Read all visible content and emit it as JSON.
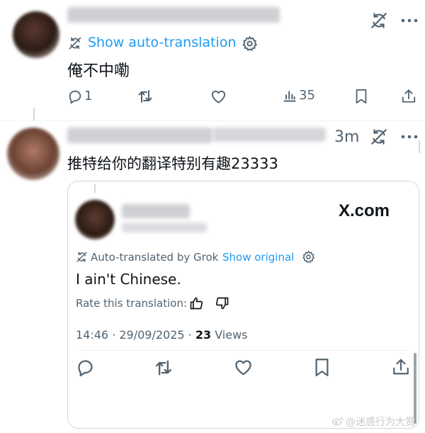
{
  "post1": {
    "show_auto_translation": "Show auto-translation",
    "content": "俺不中嘞",
    "actions": {
      "reply_count": "1",
      "views_count": "35"
    }
  },
  "post2": {
    "time": "3m",
    "content": "推特给你的翻译特别有趣23333"
  },
  "card": {
    "brand": "X.com",
    "auto_translated_by": "Auto-translated by Grok",
    "show_original": "Show original",
    "content": "I ain't Chinese.",
    "rate_label": "Rate this translation:",
    "timestamp": "14:46 · 29/09/2025 · ",
    "views_count": "23",
    "views_label": " Views"
  },
  "watermark": "@迷惑行为大赏",
  "colors": {
    "accent": "#1d9bf0",
    "text": "#0f1419",
    "muted": "#536471",
    "border": "#cfd9de"
  }
}
